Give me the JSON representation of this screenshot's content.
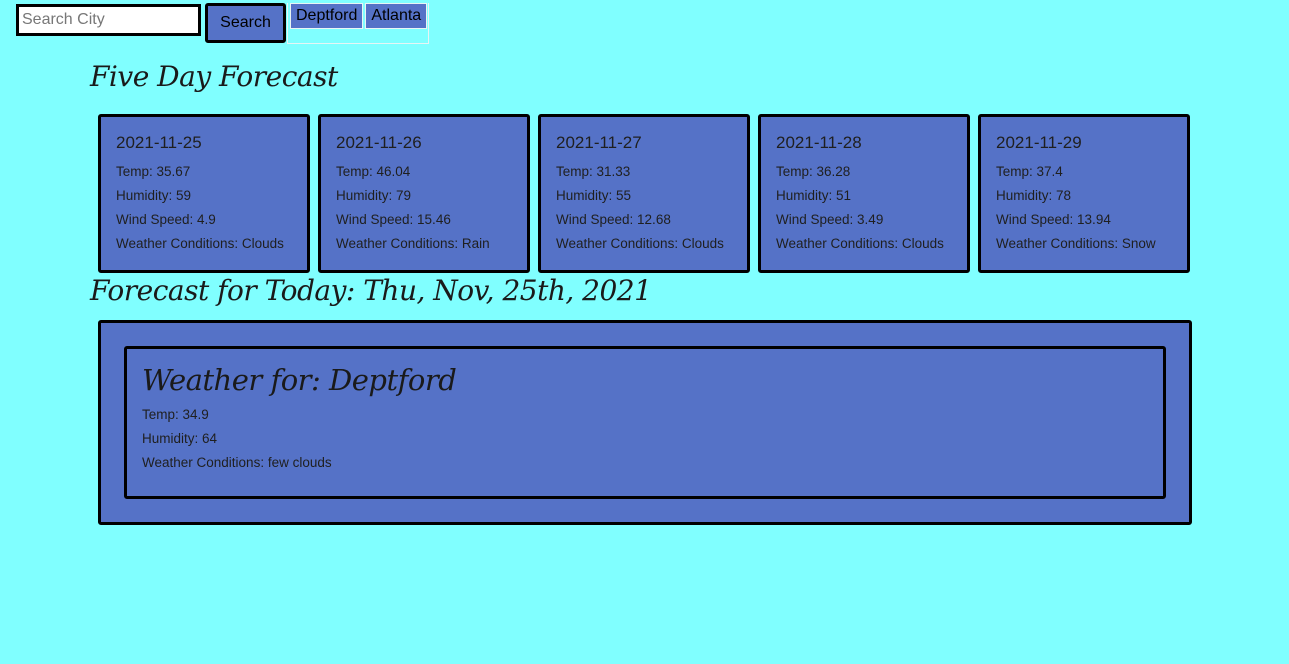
{
  "search": {
    "placeholder": "Search City",
    "value": "",
    "button_label": "Search"
  },
  "history": [
    "Deptford",
    "Atlanta"
  ],
  "five_day": {
    "title": "Five Day Forecast",
    "days": [
      {
        "date": "2021-11-25",
        "temp": "Temp: 35.67",
        "humidity": "Humidity: 59",
        "wind": "Wind Speed: 4.9",
        "conditions": "Weather Conditions: Clouds"
      },
      {
        "date": "2021-11-26",
        "temp": "Temp: 46.04",
        "humidity": "Humidity: 79",
        "wind": "Wind Speed: 15.46",
        "conditions": "Weather Conditions: Rain"
      },
      {
        "date": "2021-11-27",
        "temp": "Temp: 31.33",
        "humidity": "Humidity: 55",
        "wind": "Wind Speed: 12.68",
        "conditions": "Weather Conditions: Clouds"
      },
      {
        "date": "2021-11-28",
        "temp": "Temp: 36.28",
        "humidity": "Humidity: 51",
        "wind": "Wind Speed: 3.49",
        "conditions": "Weather Conditions: Clouds"
      },
      {
        "date": "2021-11-29",
        "temp": "Temp: 37.4",
        "humidity": "Humidity: 78",
        "wind": "Wind Speed: 13.94",
        "conditions": "Weather Conditions: Snow"
      }
    ]
  },
  "today": {
    "title": "Forecast for Today: Thu, Nov, 25th, 2021",
    "city_heading": "Weather for: Deptford",
    "temp": "Temp: 34.9",
    "humidity": "Humidity: 64",
    "conditions": "Weather Conditions: few clouds"
  },
  "colors": {
    "background": "#80ffff",
    "card": "#5572c7",
    "border": "#000000"
  }
}
